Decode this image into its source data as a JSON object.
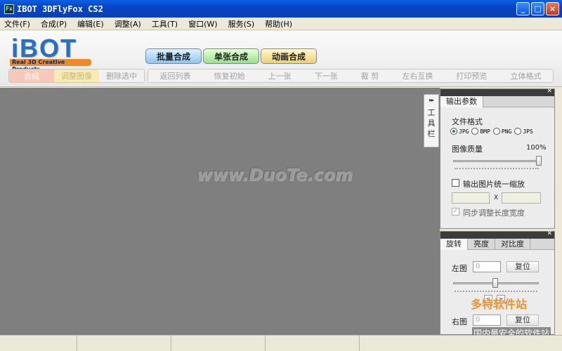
{
  "window": {
    "title": "IBOT 3DFlyFox CS2",
    "app_icon": "Fx",
    "buttons": [
      "_",
      "□",
      "×"
    ]
  },
  "menu": [
    "文件(F)",
    "合成(P)",
    "编辑(E)",
    "调整(A)",
    "工具(T)",
    "窗口(W)",
    "服务(S)",
    "帮助(H)"
  ],
  "logo": {
    "text": "iBOT",
    "sub": "Real 3D Creative Products"
  },
  "mode_tabs": {
    "batch": "批量合成",
    "single": "单张合成",
    "anim": "动画合成"
  },
  "subbar": {
    "compose": "合成",
    "adjust": "调整图像",
    "delete": "删除选中",
    "actions": [
      "返回列表",
      "恢复初始",
      "上一张",
      "下一张",
      "裁 剪",
      "左右互换",
      "打印预览",
      "立体格式"
    ]
  },
  "canvas": {
    "watermark": "www.DuoTe.com"
  },
  "toolstrip": {
    "arrows": "▸▸",
    "label": [
      "工",
      "具",
      "栏"
    ]
  },
  "output_panel": {
    "tab": "输出参数",
    "file_format_label": "文件格式",
    "formats": [
      {
        "label": "JPG",
        "selected": true
      },
      {
        "label": "BMP",
        "selected": false
      },
      {
        "label": "PNG",
        "selected": false
      },
      {
        "label": "JPS",
        "selected": false
      }
    ],
    "quality_label": "图像质量",
    "quality_value": "100%",
    "quality": 1.0,
    "scale_label": "输出图片统一缩放",
    "scale_x": "X",
    "sync_label": "同步调整长度宽度"
  },
  "adjust_panel": {
    "tabs": [
      "旋转",
      "亮度",
      "对比度"
    ],
    "left_label": "左图",
    "left_value": "0",
    "reset_label": "复位",
    "right_label": "右图",
    "right_value": "0",
    "nudge_left": "<",
    "nudge_right": ">"
  },
  "watermarks": {
    "brand": "多特软件站",
    "slogan": "国内最安全的软件站"
  }
}
